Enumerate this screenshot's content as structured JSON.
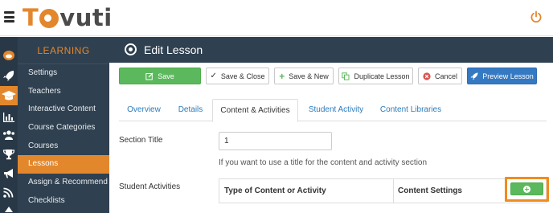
{
  "brand": {
    "logo_text": "Tovuti",
    "accent": "#e3872d"
  },
  "menu": {
    "header": "LEARNING",
    "items": [
      {
        "label": "Settings",
        "active": false
      },
      {
        "label": "Teachers",
        "active": false
      },
      {
        "label": "Interactive Content",
        "active": false
      },
      {
        "label": "Course Categories",
        "active": false
      },
      {
        "label": "Courses",
        "active": false
      },
      {
        "label": "Lessons",
        "active": true
      },
      {
        "label": "Assign & Recommend",
        "active": false
      },
      {
        "label": "Checklists",
        "active": false
      }
    ]
  },
  "rail_icons": [
    "avatar-icon",
    "rocket-icon",
    "graduation-cap-icon",
    "bar-chart-icon",
    "users-icon",
    "trophy-icon",
    "megaphone-icon",
    "rss-icon"
  ],
  "page": {
    "title": "Edit Lesson"
  },
  "toolbar": {
    "save": "Save",
    "save_close": "Save & Close",
    "save_new": "Save & New",
    "duplicate": "Duplicate Lesson",
    "cancel": "Cancel",
    "preview": "Preview Lesson"
  },
  "tabs": [
    {
      "label": "Overview",
      "active": false
    },
    {
      "label": "Details",
      "active": false
    },
    {
      "label": "Content & Activities",
      "active": true
    },
    {
      "label": "Student Activity",
      "active": false
    },
    {
      "label": "Content Libraries",
      "active": false
    }
  ],
  "form": {
    "section_title_label": "Section Title",
    "section_title_value": "1",
    "section_title_help": "If you want to use a title for the content and activity section",
    "student_activities_label": "Student Activities",
    "table_headers": [
      "Type of Content or Activity",
      "Content Settings"
    ]
  },
  "colors": {
    "sidebar": "#2f4050",
    "rail": "#293846",
    "success": "#5cb85c",
    "primary": "#3479c2",
    "danger": "#d9534f",
    "highlight": "#f28c1c"
  }
}
